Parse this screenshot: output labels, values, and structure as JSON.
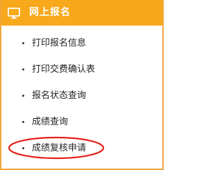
{
  "header": {
    "title": "网上报名",
    "icon": "monitor-icon",
    "background_color": "#f7a81b"
  },
  "menu": {
    "items": [
      {
        "label": "打印报名信息"
      },
      {
        "label": "打印交费确认表"
      },
      {
        "label": "报名状态查询"
      },
      {
        "label": "成绩查询"
      },
      {
        "label": "成绩复核申请"
      }
    ]
  },
  "annotation": {
    "circled_item": "成绩复核申请",
    "color": "#e8201a"
  }
}
